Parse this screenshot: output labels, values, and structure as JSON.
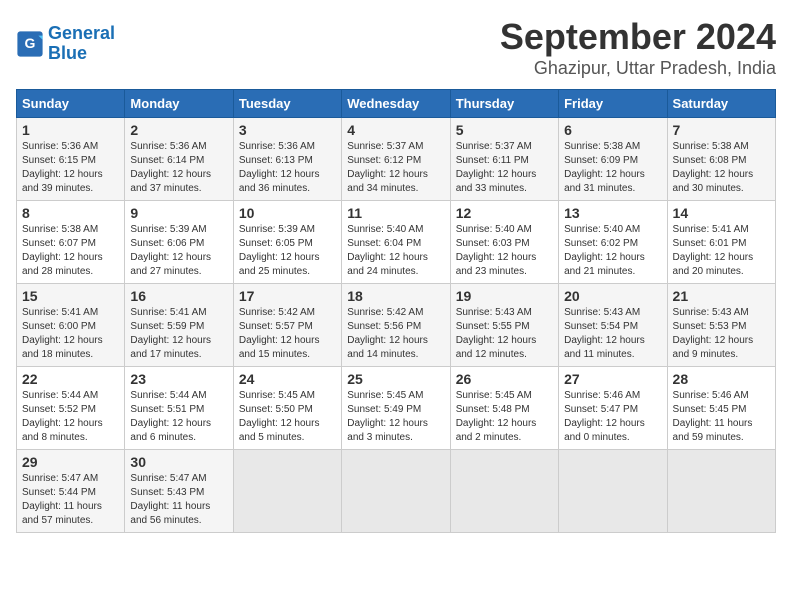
{
  "header": {
    "logo_line1": "General",
    "logo_line2": "Blue",
    "month_year": "September 2024",
    "location": "Ghazipur, Uttar Pradesh, India"
  },
  "days_of_week": [
    "Sunday",
    "Monday",
    "Tuesday",
    "Wednesday",
    "Thursday",
    "Friday",
    "Saturday"
  ],
  "weeks": [
    [
      {
        "day": "1",
        "sunrise": "5:36 AM",
        "sunset": "6:15 PM",
        "daylight": "12 hours and 39 minutes."
      },
      {
        "day": "2",
        "sunrise": "5:36 AM",
        "sunset": "6:14 PM",
        "daylight": "12 hours and 37 minutes."
      },
      {
        "day": "3",
        "sunrise": "5:36 AM",
        "sunset": "6:13 PM",
        "daylight": "12 hours and 36 minutes."
      },
      {
        "day": "4",
        "sunrise": "5:37 AM",
        "sunset": "6:12 PM",
        "daylight": "12 hours and 34 minutes."
      },
      {
        "day": "5",
        "sunrise": "5:37 AM",
        "sunset": "6:11 PM",
        "daylight": "12 hours and 33 minutes."
      },
      {
        "day": "6",
        "sunrise": "5:38 AM",
        "sunset": "6:09 PM",
        "daylight": "12 hours and 31 minutes."
      },
      {
        "day": "7",
        "sunrise": "5:38 AM",
        "sunset": "6:08 PM",
        "daylight": "12 hours and 30 minutes."
      }
    ],
    [
      {
        "day": "8",
        "sunrise": "5:38 AM",
        "sunset": "6:07 PM",
        "daylight": "12 hours and 28 minutes."
      },
      {
        "day": "9",
        "sunrise": "5:39 AM",
        "sunset": "6:06 PM",
        "daylight": "12 hours and 27 minutes."
      },
      {
        "day": "10",
        "sunrise": "5:39 AM",
        "sunset": "6:05 PM",
        "daylight": "12 hours and 25 minutes."
      },
      {
        "day": "11",
        "sunrise": "5:40 AM",
        "sunset": "6:04 PM",
        "daylight": "12 hours and 24 minutes."
      },
      {
        "day": "12",
        "sunrise": "5:40 AM",
        "sunset": "6:03 PM",
        "daylight": "12 hours and 23 minutes."
      },
      {
        "day": "13",
        "sunrise": "5:40 AM",
        "sunset": "6:02 PM",
        "daylight": "12 hours and 21 minutes."
      },
      {
        "day": "14",
        "sunrise": "5:41 AM",
        "sunset": "6:01 PM",
        "daylight": "12 hours and 20 minutes."
      }
    ],
    [
      {
        "day": "15",
        "sunrise": "5:41 AM",
        "sunset": "6:00 PM",
        "daylight": "12 hours and 18 minutes."
      },
      {
        "day": "16",
        "sunrise": "5:41 AM",
        "sunset": "5:59 PM",
        "daylight": "12 hours and 17 minutes."
      },
      {
        "day": "17",
        "sunrise": "5:42 AM",
        "sunset": "5:57 PM",
        "daylight": "12 hours and 15 minutes."
      },
      {
        "day": "18",
        "sunrise": "5:42 AM",
        "sunset": "5:56 PM",
        "daylight": "12 hours and 14 minutes."
      },
      {
        "day": "19",
        "sunrise": "5:43 AM",
        "sunset": "5:55 PM",
        "daylight": "12 hours and 12 minutes."
      },
      {
        "day": "20",
        "sunrise": "5:43 AM",
        "sunset": "5:54 PM",
        "daylight": "12 hours and 11 minutes."
      },
      {
        "day": "21",
        "sunrise": "5:43 AM",
        "sunset": "5:53 PM",
        "daylight": "12 hours and 9 minutes."
      }
    ],
    [
      {
        "day": "22",
        "sunrise": "5:44 AM",
        "sunset": "5:52 PM",
        "daylight": "12 hours and 8 minutes."
      },
      {
        "day": "23",
        "sunrise": "5:44 AM",
        "sunset": "5:51 PM",
        "daylight": "12 hours and 6 minutes."
      },
      {
        "day": "24",
        "sunrise": "5:45 AM",
        "sunset": "5:50 PM",
        "daylight": "12 hours and 5 minutes."
      },
      {
        "day": "25",
        "sunrise": "5:45 AM",
        "sunset": "5:49 PM",
        "daylight": "12 hours and 3 minutes."
      },
      {
        "day": "26",
        "sunrise": "5:45 AM",
        "sunset": "5:48 PM",
        "daylight": "12 hours and 2 minutes."
      },
      {
        "day": "27",
        "sunrise": "5:46 AM",
        "sunset": "5:47 PM",
        "daylight": "12 hours and 0 minutes."
      },
      {
        "day": "28",
        "sunrise": "5:46 AM",
        "sunset": "5:45 PM",
        "daylight": "11 hours and 59 minutes."
      }
    ],
    [
      {
        "day": "29",
        "sunrise": "5:47 AM",
        "sunset": "5:44 PM",
        "daylight": "11 hours and 57 minutes."
      },
      {
        "day": "30",
        "sunrise": "5:47 AM",
        "sunset": "5:43 PM",
        "daylight": "11 hours and 56 minutes."
      },
      null,
      null,
      null,
      null,
      null
    ]
  ]
}
